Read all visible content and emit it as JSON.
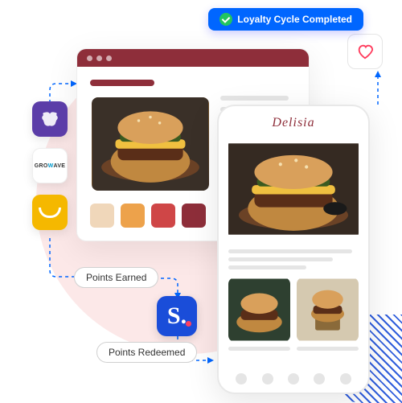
{
  "loyalty_badge": "Loyalty Cycle Completed",
  "app_brand": "Delisia",
  "pills": {
    "earned": "Points Earned",
    "redeemed": "Points Redeemed"
  },
  "integrations": {
    "lion": "loyaltylion",
    "growave_pre": "GRO",
    "growave_mid": "W",
    "growave_post": "AVE",
    "smile": "smile",
    "stamped": "S."
  },
  "swatches": [
    "#f0d7ba",
    "#eda24b",
    "#cf4647",
    "#8e2e3a"
  ]
}
